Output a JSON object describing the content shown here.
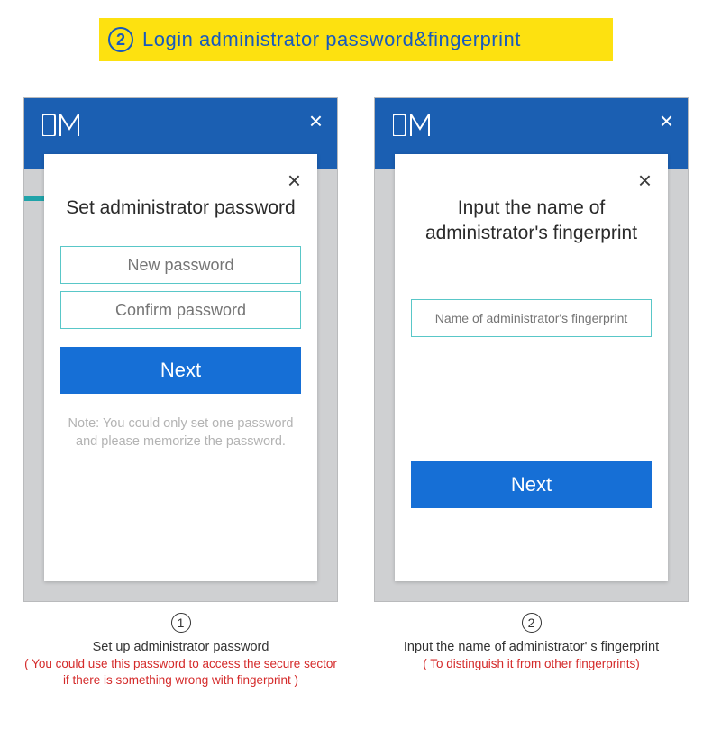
{
  "banner": {
    "step_number": "2",
    "title": "Login  administrator  password&fingerprint"
  },
  "left_panel": {
    "logo_text": "DM",
    "dialog_title": "Set  administrator password",
    "input1_placeholder": "New password",
    "input2_placeholder": "Confirm password",
    "next_button": "Next",
    "note": "Note: You could only set one password and please memorize the  password."
  },
  "right_panel": {
    "logo_text": "DM",
    "dialog_title": "Input the name of administrator's fingerprint",
    "input_placeholder": "Name of administrator's fingerprint",
    "next_button": "Next"
  },
  "captions": {
    "left": {
      "number": "1",
      "line1": "Set up administrator password",
      "line2": "( You could use this password to access the secure sector if there is something wrong with fingerprint )"
    },
    "right": {
      "number": "2",
      "line1": "Input the name of administrator' s fingerprint",
      "line2": "( To  distinguish it from other fingerprints)"
    }
  }
}
